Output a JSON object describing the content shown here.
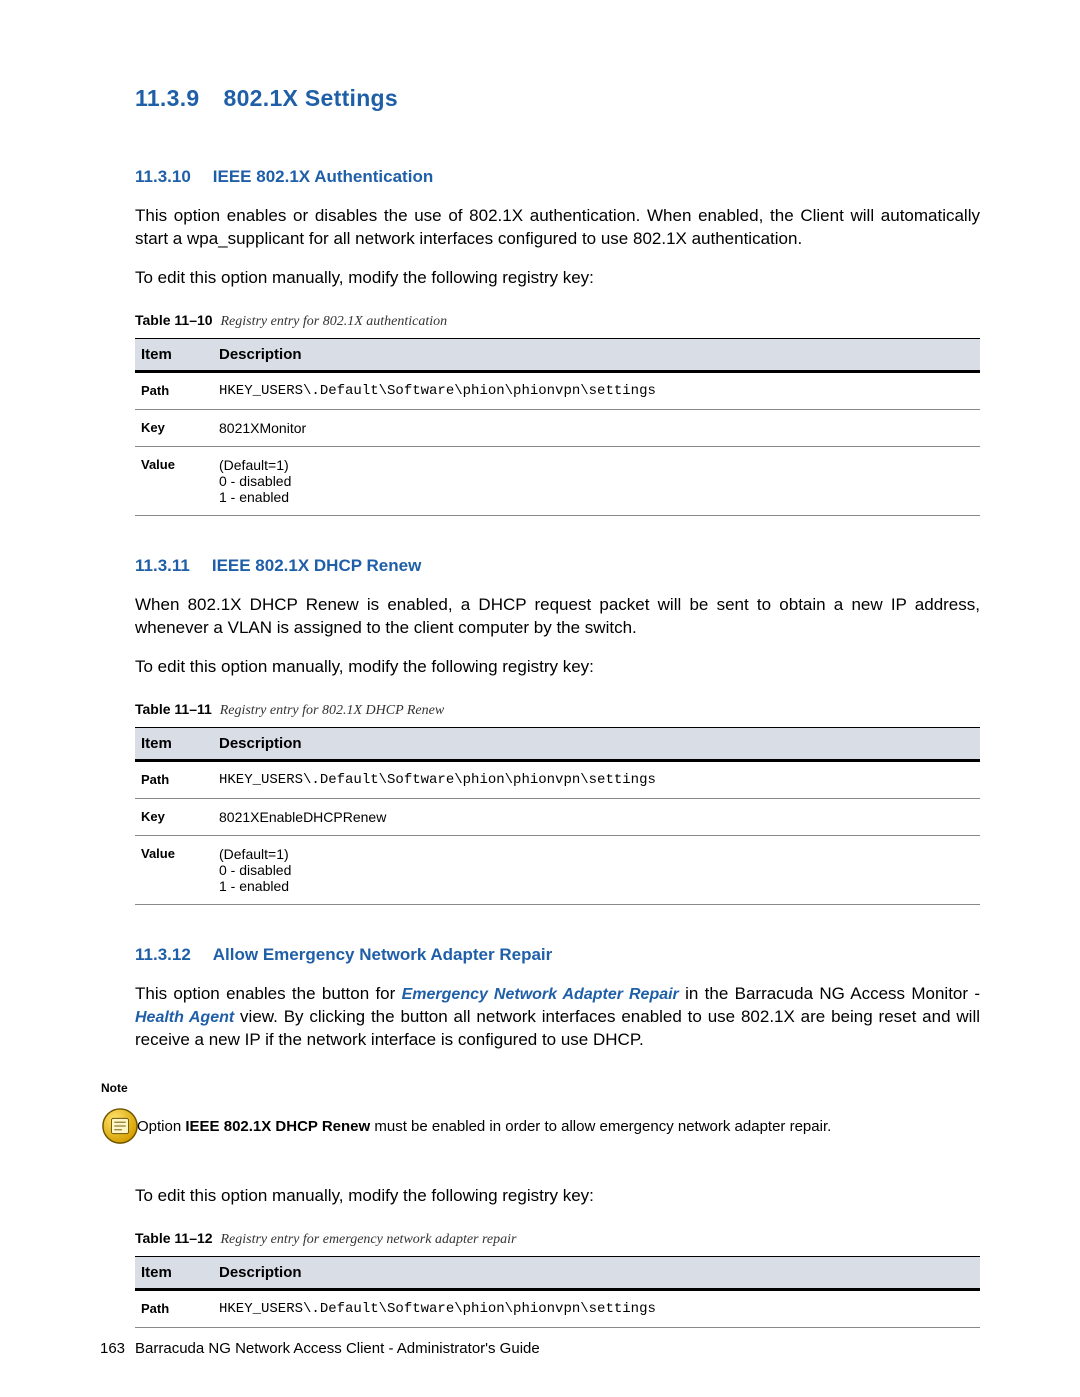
{
  "h2": {
    "num": "11.3.9",
    "title": "802.1X Settings"
  },
  "s10": {
    "num": "11.3.10",
    "title": "IEEE 802.1X Authentication",
    "p1": "This option enables or disables the use of 802.1X authentication. When enabled, the Client will automatically start a wpa_supplicant for all network interfaces configured to use 802.1X authentication.",
    "p2": "To edit this option manually, modify the following registry key:",
    "tcap_b": "Table 11–10",
    "tcap_i": "Registry entry for 802.1X authentication",
    "thead": {
      "c1": "Item",
      "c2": "Description"
    },
    "rows": {
      "path_k": "Path",
      "path_v": "HKEY_USERS\\.Default\\Software\\phion\\phionvpn\\settings",
      "key_k": "Key",
      "key_v": "8021XMonitor",
      "val_k": "Value",
      "val_v": "(Default=1)\n0 - disabled\n1 - enabled"
    }
  },
  "s11": {
    "num": "11.3.11",
    "title": "IEEE 802.1X DHCP Renew",
    "p1": "When 802.1X DHCP Renew is enabled, a DHCP request packet will be sent to obtain a new IP address, whenever a VLAN is assigned to the client computer by the switch.",
    "p2": "To edit this option manually, modify the following registry key:",
    "tcap_b": "Table 11–11",
    "tcap_i": "Registry entry for 802.1X DHCP Renew",
    "thead": {
      "c1": "Item",
      "c2": "Description"
    },
    "rows": {
      "path_k": "Path",
      "path_v": "HKEY_USERS\\.Default\\Software\\phion\\phionvpn\\settings",
      "key_k": "Key",
      "key_v": "8021XEnableDHCPRenew",
      "val_k": "Value",
      "val_v": "(Default=1)\n0 - disabled\n1 - enabled"
    }
  },
  "s12": {
    "num": "11.3.12",
    "title": "Allow Emergency Network Adapter Repair",
    "p1a": "This option enables the button for ",
    "link1": "Emergency Network Adapter Repair",
    "p1b": " in the Barracuda NG Access Monitor - ",
    "link2": "Health Agent",
    "p1c": " view. By clicking the button all network interfaces enabled to use 802.1X are being reset and will receive a new IP if the network interface is configured to use DHCP.",
    "note_label": "Note",
    "note_pre": "Option ",
    "note_bold": "IEEE 802.1X DHCP Renew",
    "note_post": " must be enabled in order to allow emergency network adapter repair.",
    "p2": "To edit this option manually, modify the following registry key:",
    "tcap_b": "Table 11–12",
    "tcap_i": "Registry entry for emergency network adapter repair",
    "thead": {
      "c1": "Item",
      "c2": "Description"
    },
    "rows": {
      "path_k": "Path",
      "path_v": "HKEY_USERS\\.Default\\Software\\phion\\phionvpn\\settings"
    }
  },
  "footer": {
    "page": "163",
    "title": "Barracuda NG Network Access Client - Administrator's Guide"
  }
}
